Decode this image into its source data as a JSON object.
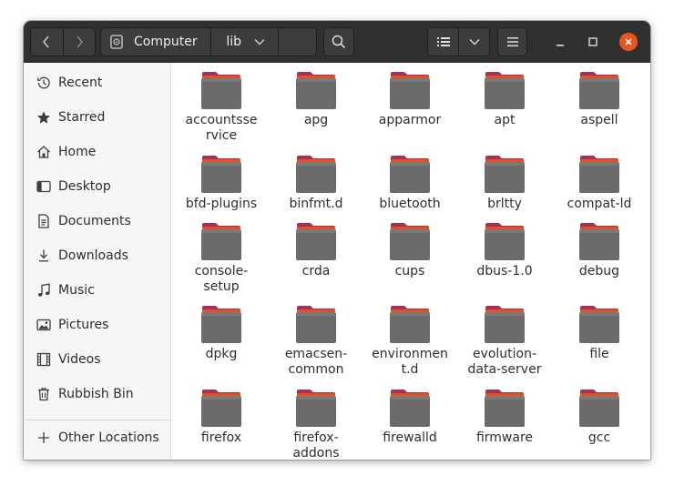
{
  "window": {
    "path": [
      {
        "label": "Computer",
        "icon": "drive-icon"
      },
      {
        "label": "lib",
        "icon": "chevron-down-icon"
      }
    ]
  },
  "sidebar": {
    "items": [
      {
        "label": "Recent",
        "icon": "recent-icon"
      },
      {
        "label": "Starred",
        "icon": "star-icon"
      },
      {
        "label": "Home",
        "icon": "home-icon"
      },
      {
        "label": "Desktop",
        "icon": "desktop-icon"
      },
      {
        "label": "Documents",
        "icon": "documents-icon"
      },
      {
        "label": "Downloads",
        "icon": "downloads-icon"
      },
      {
        "label": "Music",
        "icon": "music-icon"
      },
      {
        "label": "Pictures",
        "icon": "pictures-icon"
      },
      {
        "label": "Videos",
        "icon": "videos-icon"
      },
      {
        "label": "Rubbish Bin",
        "icon": "trash-icon"
      }
    ],
    "other": {
      "label": "Other Locations",
      "icon": "plus-icon"
    }
  },
  "folders": [
    {
      "name": "accountsservice",
      "lines": [
        "accountsse",
        "rvice"
      ]
    },
    {
      "name": "apg",
      "lines": [
        "apg"
      ]
    },
    {
      "name": "apparmor",
      "lines": [
        "apparmor"
      ]
    },
    {
      "name": "apt",
      "lines": [
        "apt"
      ]
    },
    {
      "name": "aspell",
      "lines": [
        "aspell"
      ]
    },
    {
      "name": "bfd-plugins",
      "lines": [
        "bfd-plugins"
      ]
    },
    {
      "name": "binfmt.d",
      "lines": [
        "binfmt.d"
      ]
    },
    {
      "name": "bluetooth",
      "lines": [
        "bluetooth"
      ]
    },
    {
      "name": "brltty",
      "lines": [
        "brltty"
      ]
    },
    {
      "name": "compat-ld",
      "lines": [
        "compat-ld"
      ]
    },
    {
      "name": "console-setup",
      "lines": [
        "console-",
        "setup"
      ]
    },
    {
      "name": "crda",
      "lines": [
        "crda"
      ]
    },
    {
      "name": "cups",
      "lines": [
        "cups"
      ]
    },
    {
      "name": "dbus-1.0",
      "lines": [
        "dbus-1.0"
      ]
    },
    {
      "name": "debug",
      "lines": [
        "debug"
      ]
    },
    {
      "name": "dpkg",
      "lines": [
        "dpkg"
      ]
    },
    {
      "name": "emacsen-common",
      "lines": [
        "emacsen-",
        "common"
      ]
    },
    {
      "name": "environment.d",
      "lines": [
        "environmen",
        "t.d"
      ]
    },
    {
      "name": "evolution-data-server",
      "lines": [
        "evolution-",
        "data-server"
      ]
    },
    {
      "name": "file",
      "lines": [
        "file"
      ]
    },
    {
      "name": "firefox",
      "lines": [
        "firefox"
      ]
    },
    {
      "name": "firefox-addons",
      "lines": [
        "firefox-",
        "addons"
      ]
    },
    {
      "name": "firewalld",
      "lines": [
        "firewalld"
      ]
    },
    {
      "name": "firmware",
      "lines": [
        "firmware"
      ]
    },
    {
      "name": "gcc",
      "lines": [
        "gcc"
      ]
    }
  ],
  "colors": {
    "accent": "#e95420",
    "folder_tab": "#a3315a",
    "folder_body": "#6b6b6b"
  }
}
